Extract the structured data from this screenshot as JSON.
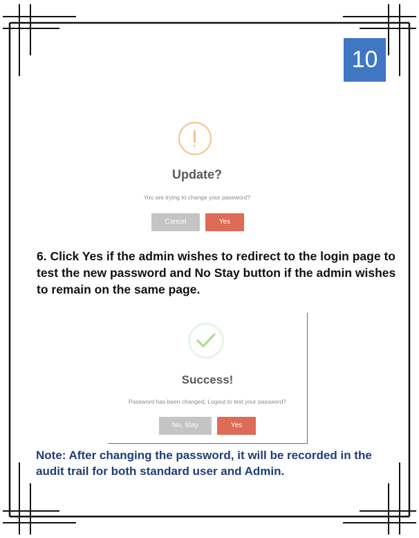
{
  "page_number": "10",
  "colors": {
    "badge": "#3f77c2",
    "warning": "#f2c48f",
    "success": "#a5dc86",
    "yes_button": "#dd6b55",
    "neutral_button": "#c4c4c4",
    "note_text": "#1f3d7a"
  },
  "dialog_update": {
    "icon": "exclamation-icon",
    "title": "Update?",
    "message": "You are trying to change your password?",
    "cancel_label": "Cancel",
    "yes_label": "Yes"
  },
  "instruction": "6. Click Yes if the admin wishes to redirect to the login page to test the new password and No Stay button if the admin wishes to remain on the same page.",
  "dialog_success": {
    "icon": "checkmark-icon",
    "title": "Success!",
    "message": "Password has been changed, Logout to test your password?",
    "no_stay_label": "No, Stay",
    "yes_label": "Yes"
  },
  "note": "Note: After changing the password, it will be recorded in the audit trail for both standard user and Admin."
}
